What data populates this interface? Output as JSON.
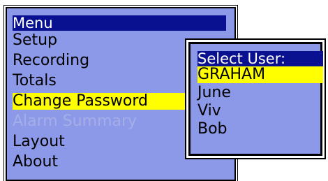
{
  "main_menu": {
    "title": "Menu",
    "items": [
      {
        "label": "Setup",
        "state": "normal",
        "has_submenu": true
      },
      {
        "label": "Recording",
        "state": "normal"
      },
      {
        "label": "Totals",
        "state": "normal"
      },
      {
        "label": "Change Password",
        "state": "selected"
      },
      {
        "label": "Alarm Summary",
        "state": "disabled"
      },
      {
        "label": "Layout",
        "state": "normal"
      },
      {
        "label": "About",
        "state": "normal"
      }
    ]
  },
  "user_menu": {
    "title": "Select User:",
    "items": [
      {
        "label": "GRAHAM",
        "state": "selected"
      },
      {
        "label": "June",
        "state": "normal"
      },
      {
        "label": "Viv",
        "state": "normal"
      },
      {
        "label": "Bob",
        "state": "normal"
      }
    ]
  },
  "colors": {
    "panel_bg": "#8b99e8",
    "header_bg": "#0a1190",
    "selected_bg": "#ffff00",
    "disabled_text": "#a6aee8"
  },
  "icons": {
    "submenu": "chevron-right-icon"
  }
}
